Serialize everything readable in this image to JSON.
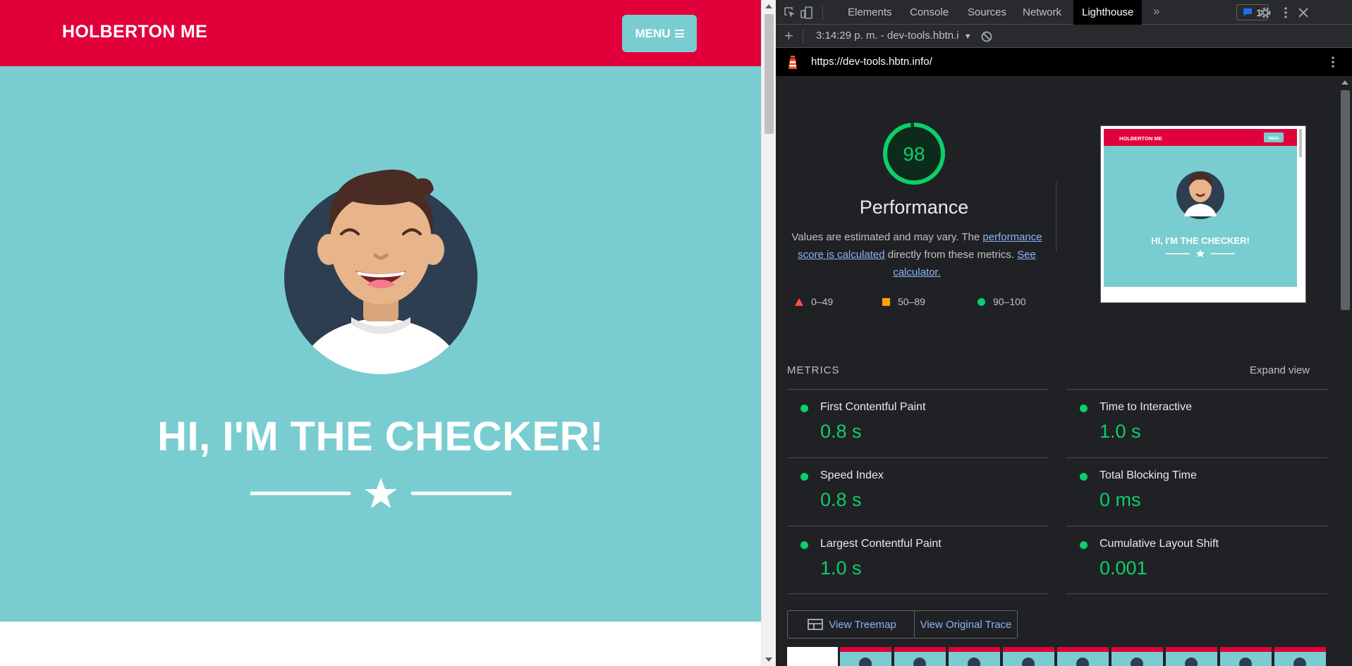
{
  "site": {
    "logo": "HOLBERTON ME",
    "menu_label": "MENU",
    "hero_title": "HI, I'M THE CHECKER!",
    "colors": {
      "header": "#e2003b",
      "hero": "#79cdd1",
      "accent": "#79cdd1"
    }
  },
  "devtools": {
    "tabs": [
      {
        "label": "Elements",
        "active": false
      },
      {
        "label": "Console",
        "active": false
      },
      {
        "label": "Sources",
        "active": false
      },
      {
        "label": "Network",
        "active": false
      },
      {
        "label": "Lighthouse",
        "active": true
      }
    ],
    "issues_count": "1",
    "toolbar": {
      "report_label": "3:14:29 p. m. - dev-tools.hbtn.i"
    },
    "url": "https://dev-tools.hbtn.info/",
    "performance": {
      "score": "98",
      "score_value": 98,
      "title": "Performance",
      "desc_prefix": "Values are estimated and may vary. The ",
      "desc_link1": "performance score is calculated",
      "desc_middle": " directly from these metrics. ",
      "desc_link2": "See calculator.",
      "legend": [
        {
          "range": "0–49",
          "shape": "triangle",
          "color": "#ff4e42"
        },
        {
          "range": "50–89",
          "shape": "square",
          "color": "#ffa400"
        },
        {
          "range": "90–100",
          "shape": "circle",
          "color": "#0cce6b"
        }
      ]
    },
    "thumbnail": {
      "logo": "HOLBERTON ME",
      "menu": "MENU",
      "title": "HI, I'M THE CHECKER!"
    },
    "metrics_title": "METRICS",
    "expand_view": "Expand view",
    "metrics": [
      {
        "name": "First Contentful Paint",
        "value": "0.8 s"
      },
      {
        "name": "Time to Interactive",
        "value": "1.0 s"
      },
      {
        "name": "Speed Index",
        "value": "0.8 s"
      },
      {
        "name": "Total Blocking Time",
        "value": "0 ms"
      },
      {
        "name": "Largest Contentful Paint",
        "value": "1.0 s"
      },
      {
        "name": "Cumulative Layout Shift",
        "value": "0.001"
      }
    ],
    "buttons": {
      "treemap": "View Treemap",
      "trace": "View Original Trace"
    }
  }
}
